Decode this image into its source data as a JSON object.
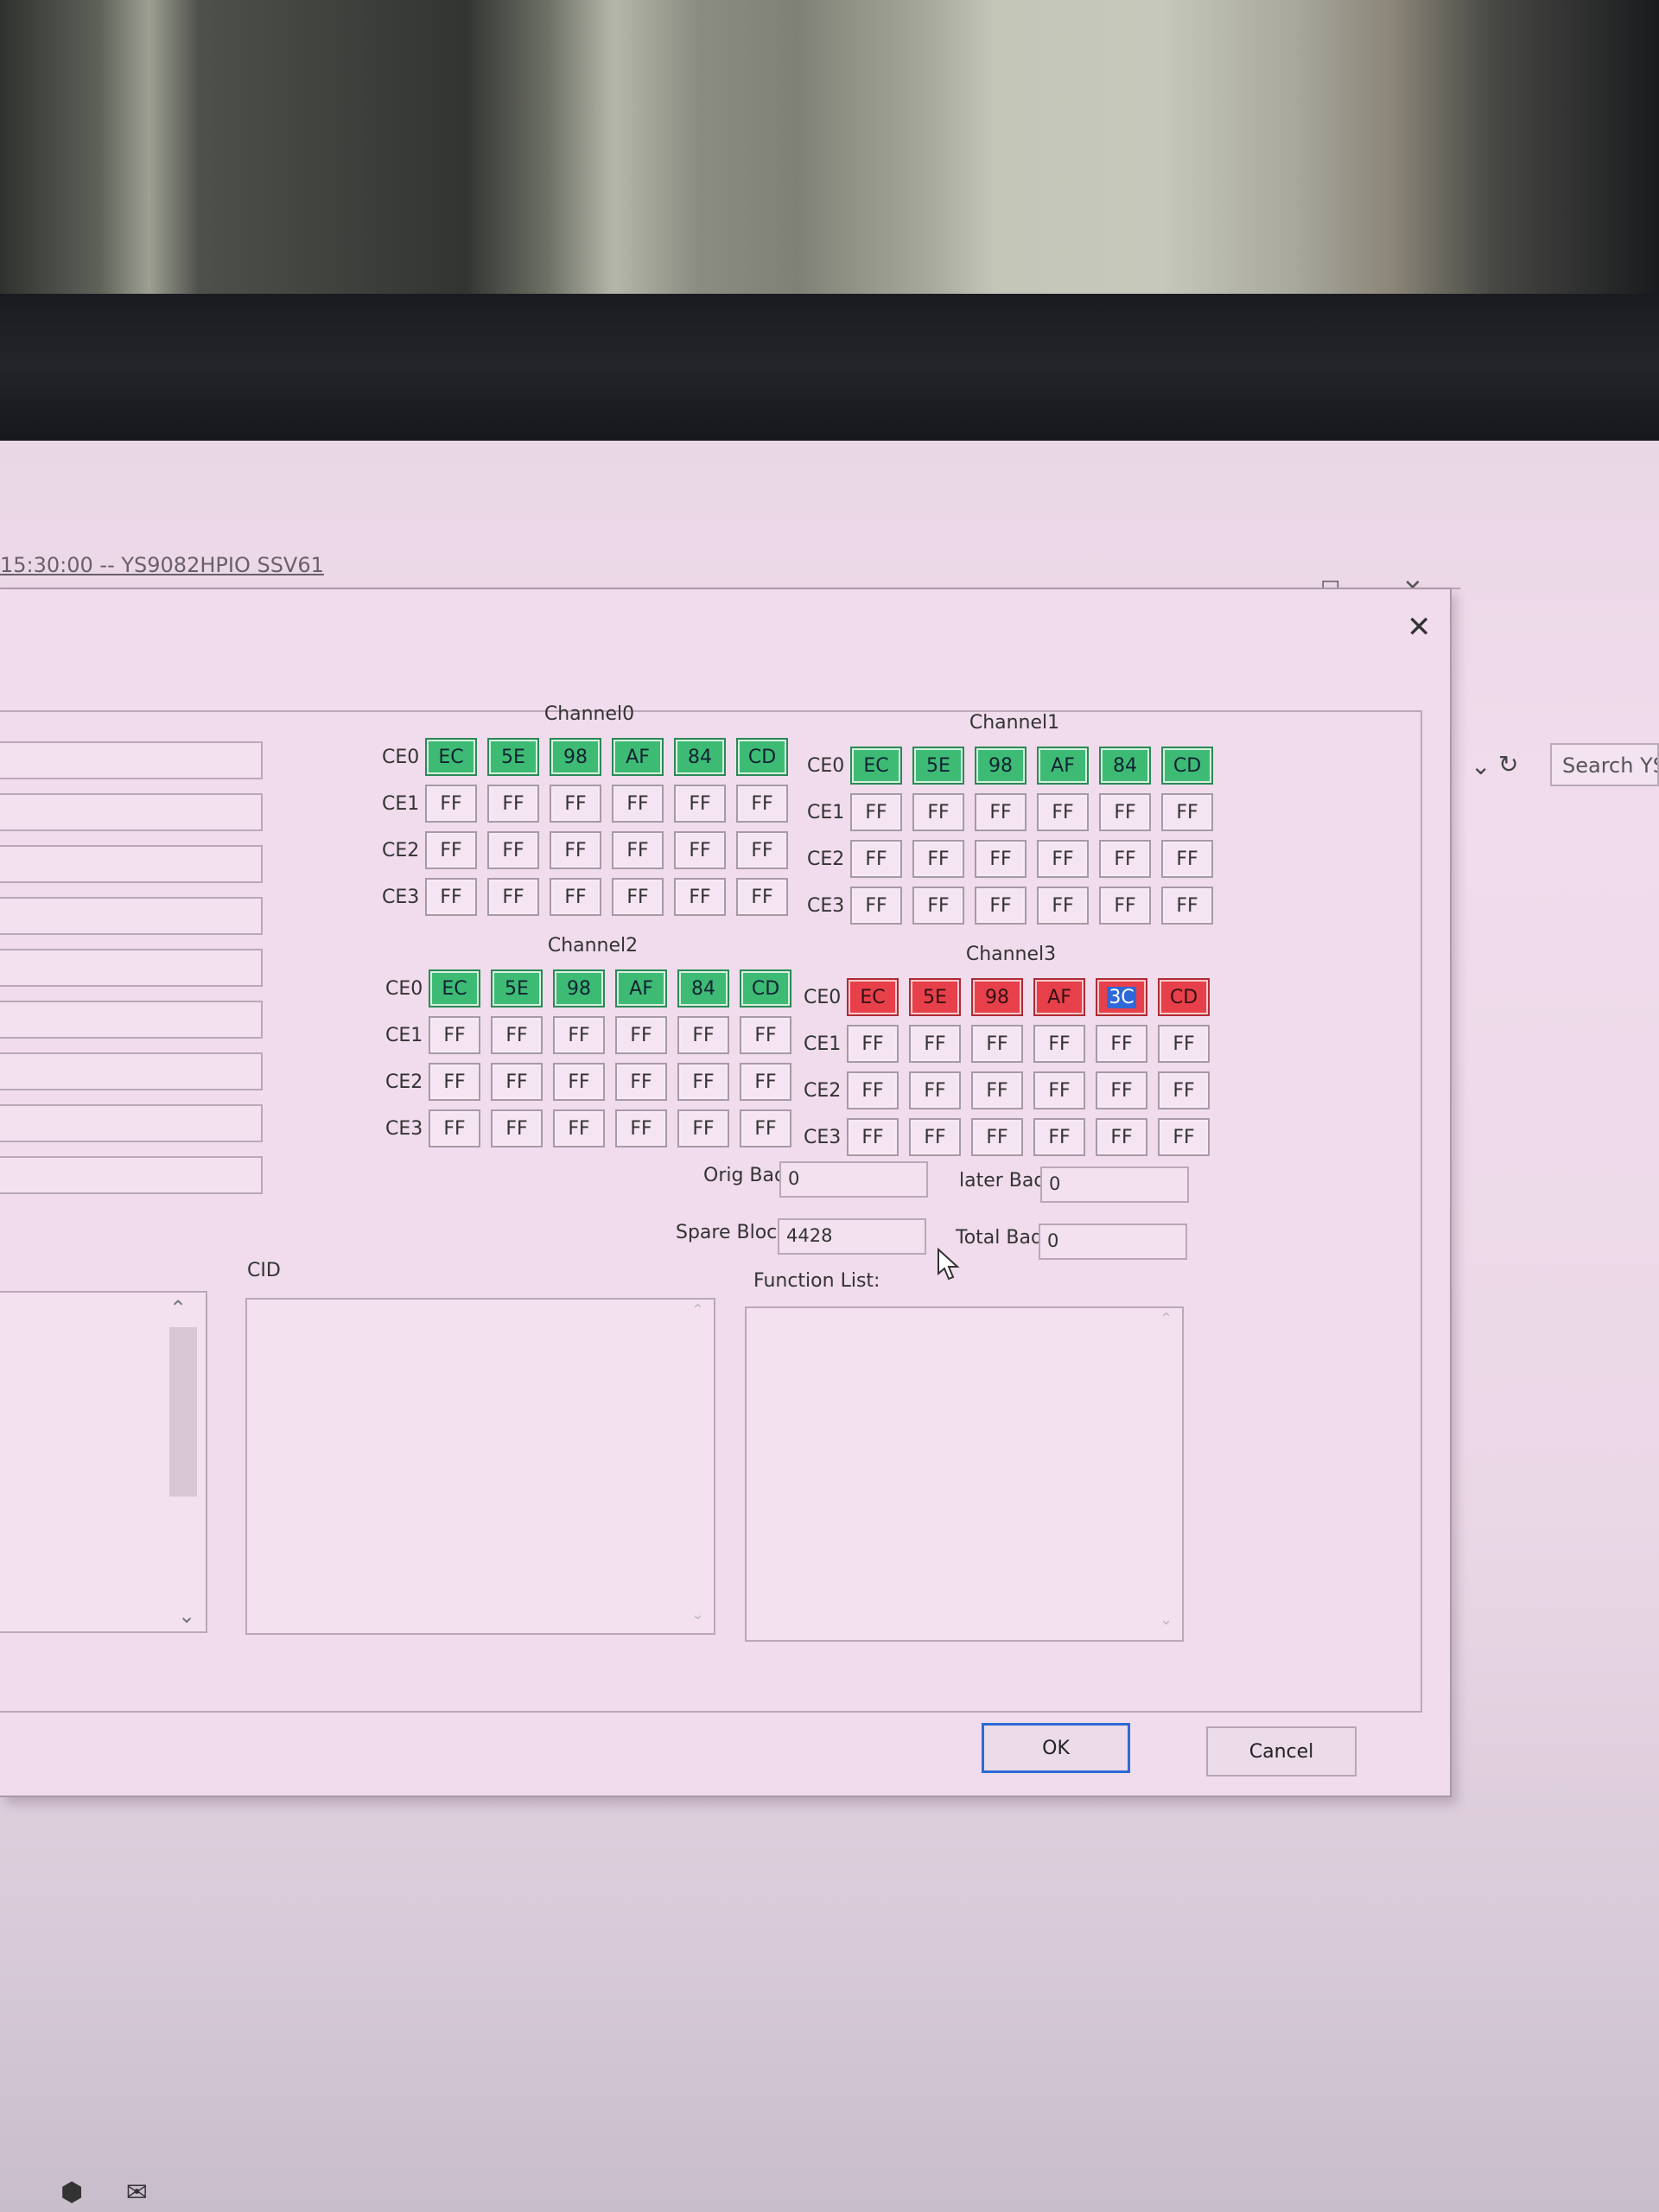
{
  "background": {
    "title": "15:30:00 -- YS9082HPIO SSV61",
    "search_label": "Search YS"
  },
  "dialog": {
    "channels": [
      {
        "title": "Channel0",
        "rows": [
          {
            "label": "CE0",
            "cells": [
              "EC",
              "5E",
              "98",
              "AF",
              "84",
              "CD"
            ],
            "status": "green"
          },
          {
            "label": "CE1",
            "cells": [
              "FF",
              "FF",
              "FF",
              "FF",
              "FF",
              "FF"
            ],
            "status": "none"
          },
          {
            "label": "CE2",
            "cells": [
              "FF",
              "FF",
              "FF",
              "FF",
              "FF",
              "FF"
            ],
            "status": "none"
          },
          {
            "label": "CE3",
            "cells": [
              "FF",
              "FF",
              "FF",
              "FF",
              "FF",
              "FF"
            ],
            "status": "none"
          }
        ]
      },
      {
        "title": "Channel1",
        "rows": [
          {
            "label": "CE0",
            "cells": [
              "EC",
              "5E",
              "98",
              "AF",
              "84",
              "CD"
            ],
            "status": "green"
          },
          {
            "label": "CE1",
            "cells": [
              "FF",
              "FF",
              "FF",
              "FF",
              "FF",
              "FF"
            ],
            "status": "none"
          },
          {
            "label": "CE2",
            "cells": [
              "FF",
              "FF",
              "FF",
              "FF",
              "FF",
              "FF"
            ],
            "status": "none"
          },
          {
            "label": "CE3",
            "cells": [
              "FF",
              "FF",
              "FF",
              "FF",
              "FF",
              "FF"
            ],
            "status": "none"
          }
        ]
      },
      {
        "title": "Channel2",
        "rows": [
          {
            "label": "CE0",
            "cells": [
              "EC",
              "5E",
              "98",
              "AF",
              "84",
              "CD"
            ],
            "status": "green"
          },
          {
            "label": "CE1",
            "cells": [
              "FF",
              "FF",
              "FF",
              "FF",
              "FF",
              "FF"
            ],
            "status": "none"
          },
          {
            "label": "CE2",
            "cells": [
              "FF",
              "FF",
              "FF",
              "FF",
              "FF",
              "FF"
            ],
            "status": "none"
          },
          {
            "label": "CE3",
            "cells": [
              "FF",
              "FF",
              "FF",
              "FF",
              "FF",
              "FF"
            ],
            "status": "none"
          }
        ]
      },
      {
        "title": "Channel3",
        "rows": [
          {
            "label": "CE0",
            "cells": [
              "EC",
              "5E",
              "98",
              "AF",
              "3C",
              "CD"
            ],
            "status": "red",
            "selected_index": 4
          },
          {
            "label": "CE1",
            "cells": [
              "FF",
              "FF",
              "FF",
              "FF",
              "FF",
              "FF"
            ],
            "status": "none"
          },
          {
            "label": "CE2",
            "cells": [
              "FF",
              "FF",
              "FF",
              "FF",
              "FF",
              "FF"
            ],
            "status": "none"
          },
          {
            "label": "CE3",
            "cells": [
              "FF",
              "FF",
              "FF",
              "FF",
              "FF",
              "FF"
            ],
            "status": "none"
          }
        ]
      }
    ],
    "stats": {
      "orig_bad_label": "Orig Bad",
      "orig_bad_value": "0",
      "later_bad_label": "later Bad",
      "later_bad_value": "0",
      "spare_block_label": "Spare Block",
      "spare_block_value": "4428",
      "total_bad_label": "Total Bad",
      "total_bad_value": "0"
    },
    "cid_label": "CID",
    "function_list_label": "Function List:",
    "ok_label": "OK",
    "cancel_label": "Cancel"
  },
  "colors": {
    "good": "#3dbb74",
    "bad": "#e8404b",
    "selection": "#2f68d8"
  }
}
